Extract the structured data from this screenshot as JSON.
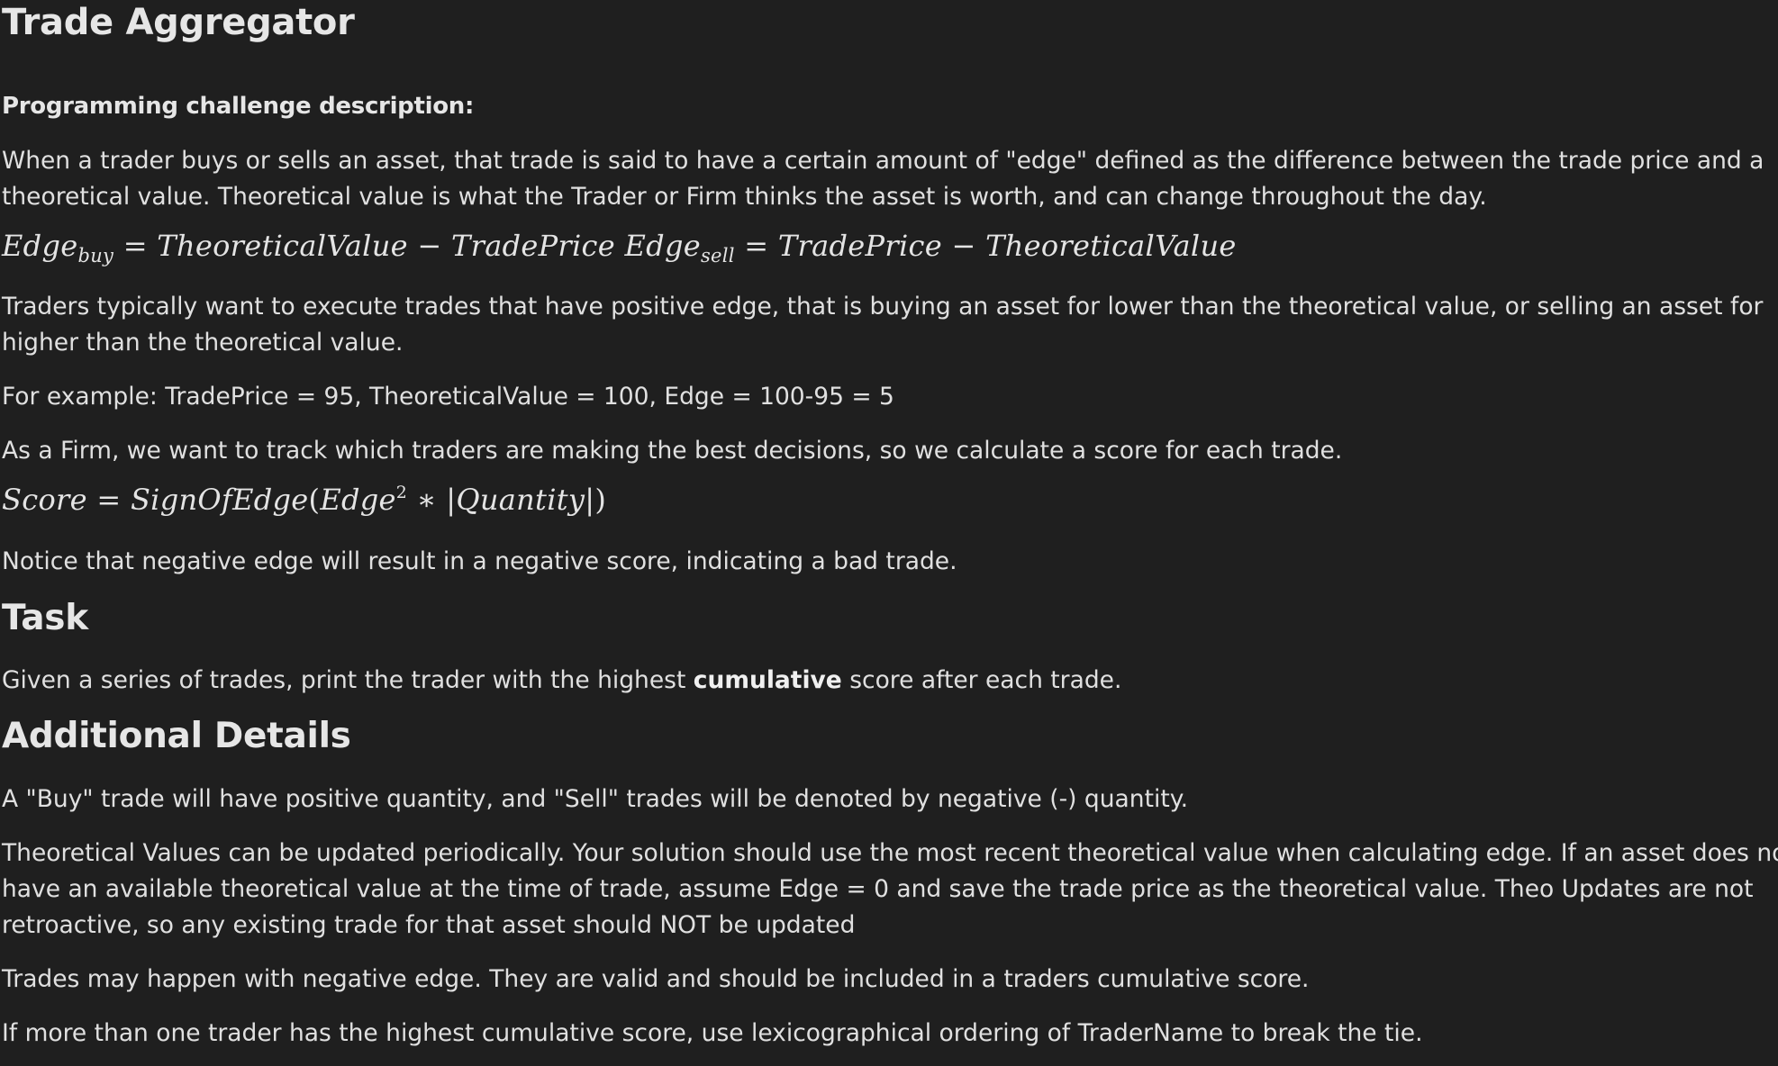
{
  "title": "Trade Aggregator",
  "challenge_heading": "Programming challenge description:",
  "intro_line1": "When a trader buys or sells an asset, that trade is said to have a certain amount of \"edge\" defined as the difference between the trade price and a",
  "intro_line2": "theoretical value. Theoretical value is what the Trader or Firm thinks the asset is worth, and can change throughout the day.",
  "edge_formula": {
    "edge": "Edge",
    "buy_sub": "buy",
    "sell_sub": "sell",
    "eq": "=",
    "minus": "−",
    "theo": "TheoreticalValue",
    "price": "TradePrice"
  },
  "positive_line1": "Traders typically want to execute trades that have positive edge, that is buying an asset for lower than the theoretical value, or selling an asset for",
  "positive_line2": "higher than the theoretical value.",
  "example": "For example: TradePrice = 95, TheoreticalValue = 100, Edge = 100-95 = 5",
  "firm_line": "As a Firm, we want to track which traders are making the best decisions, so we calculate a score for each trade.",
  "score_formula": {
    "score": "Score",
    "eq": "=",
    "sign": "SignOfEdge",
    "lparen": "(",
    "edge": "Edge",
    "sup": "2",
    "times": "∗",
    "abs_open": "|",
    "quantity": "Quantity",
    "abs_close": "|",
    "rparen": ")"
  },
  "notice": "Notice that negative edge will result in a negative score, indicating a bad trade.",
  "task_heading": "Task",
  "task_before": "Given a series of trades, print the trader with the highest ",
  "task_bold": "cumulative",
  "task_after": " score after each trade.",
  "details_heading": "Additional Details",
  "detail_buy_sell": "A \"Buy\" trade will have positive quantity, and \"Sell\" trades will be denoted by negative (-) quantity.",
  "detail_theo_line1": "Theoretical Values can be updated periodically. Your solution should use the most recent theoretical value when calculating edge. If an asset does no",
  "detail_theo_line2": "have an available theoretical value at the time of trade, assume Edge = 0 and save the trade price as the theoretical value. Theo Updates are not",
  "detail_theo_line3": "retroactive, so any existing trade for that asset should NOT be updated",
  "detail_negative": "Trades may happen with negative edge. They are valid and should be included in a traders cumulative score.",
  "detail_tie": "If more than one trader has the highest cumulative score, use lexicographical ordering of TraderName to break the tie."
}
